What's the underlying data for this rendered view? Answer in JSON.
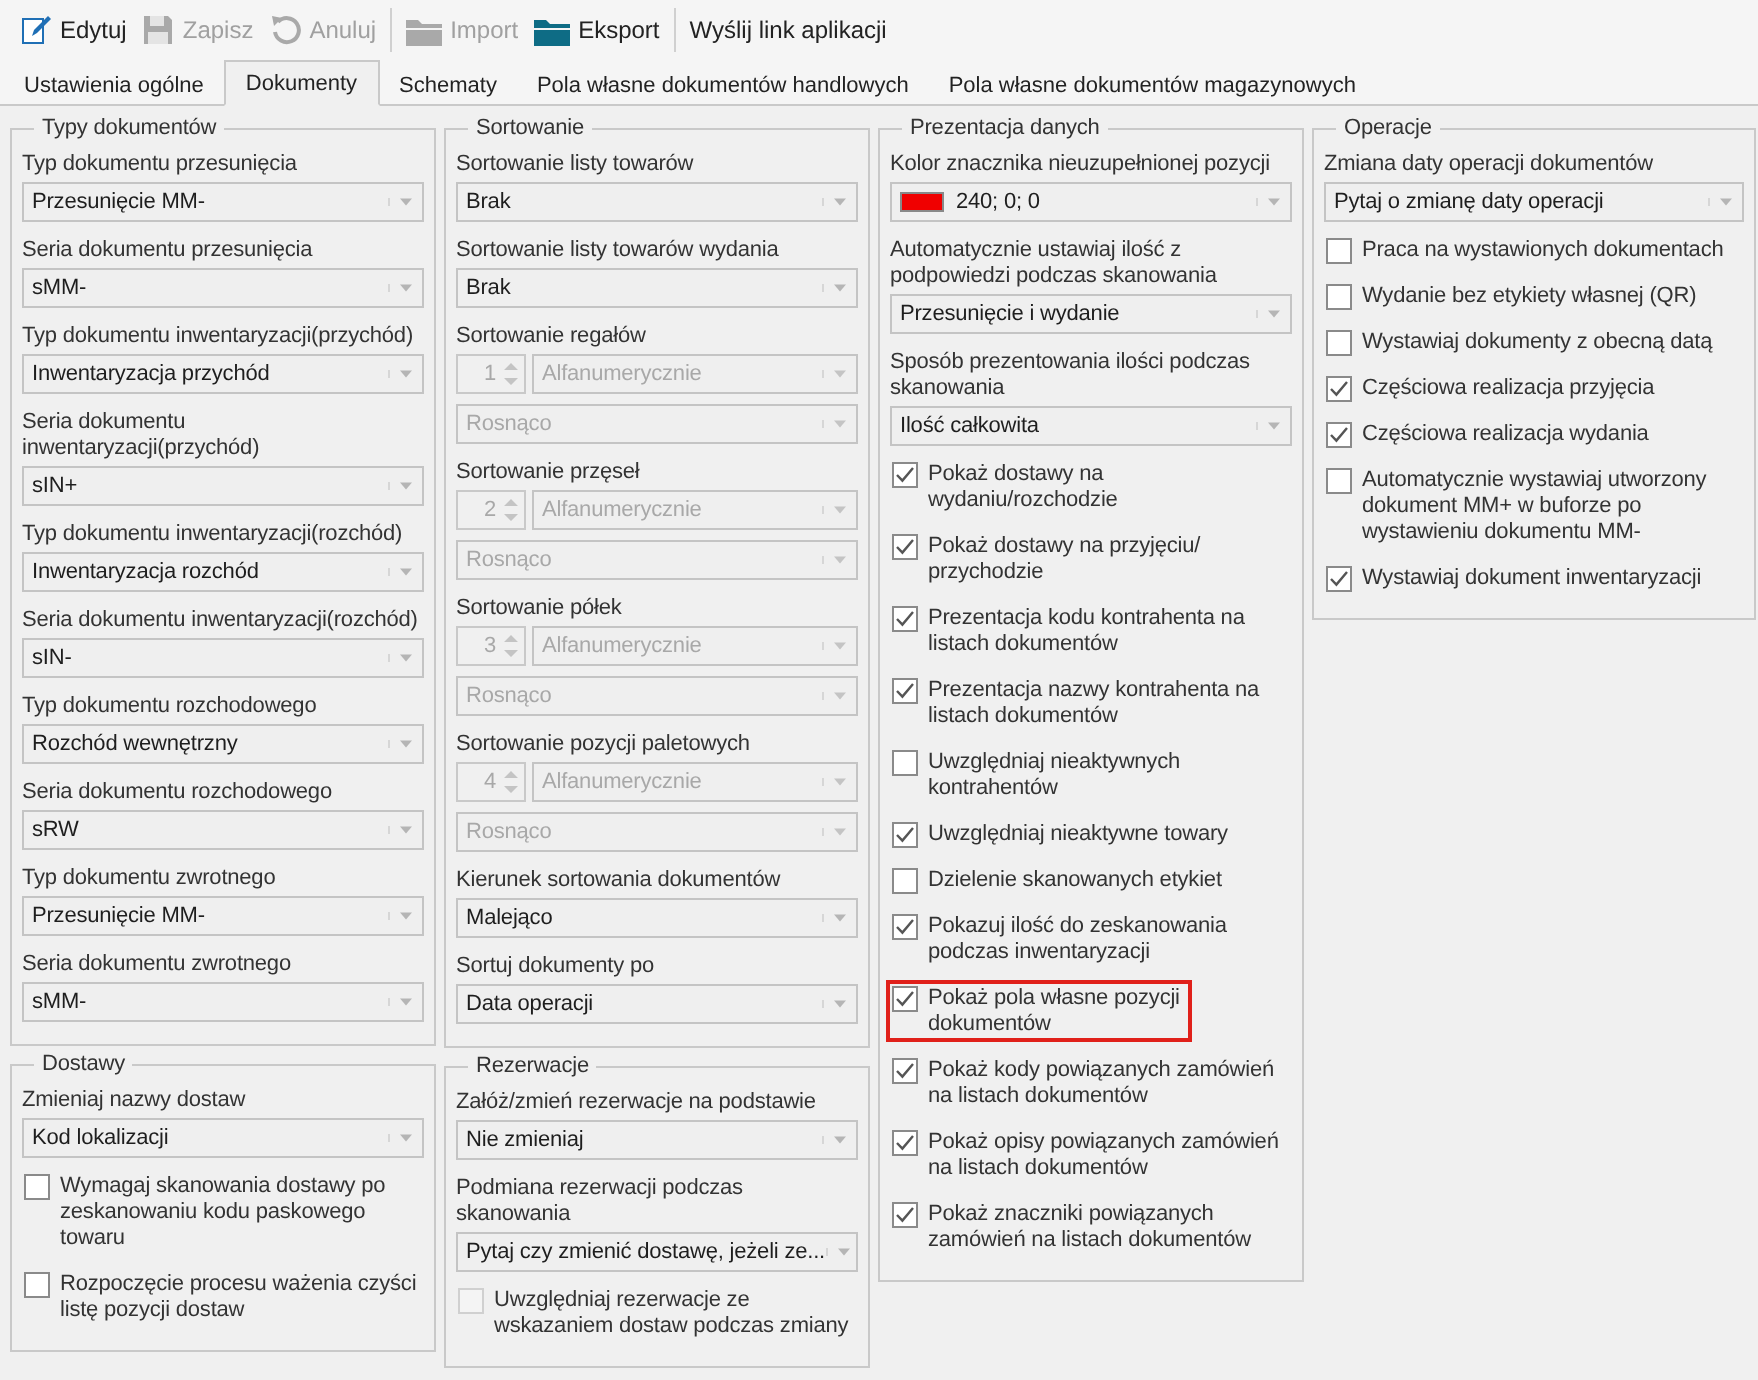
{
  "toolbar": [
    [
      {
        "label": "Edytuj",
        "kind": "edit",
        "disabled": false
      },
      {
        "label": "Zapisz",
        "kind": "save",
        "disabled": true
      },
      {
        "label": "Anuluj",
        "kind": "undo",
        "disabled": true
      }
    ],
    [
      {
        "label": "Import",
        "kind": "folder",
        "disabled": true
      },
      {
        "label": "Eksport",
        "kind": "folder",
        "disabled": false
      }
    ],
    [
      {
        "label": "Wyślij link aplikacji",
        "kind": "text",
        "disabled": false
      }
    ]
  ],
  "tabs": [
    {
      "label": "Ustawienia ogólne",
      "selected": false
    },
    {
      "label": "Dokumenty",
      "selected": true
    },
    {
      "label": "Schematy",
      "selected": false
    },
    {
      "label": "Pola własne dokumentów handlowych",
      "selected": false
    },
    {
      "label": "Pola własne dokumentów magazynowych",
      "selected": false
    }
  ],
  "columns": [
    {
      "groups": [
        {
          "title": "Typy dokumentów",
          "items": [
            {
              "kind": "select",
              "label": "Typ dokumentu przesunięcia",
              "value": "Przesunięcie MM-"
            },
            {
              "kind": "select",
              "label": "Seria dokumentu przesunięcia",
              "value": "sMM-"
            },
            {
              "kind": "select",
              "label": "Typ dokumentu inwentaryzacji(przychód)",
              "value": "Inwentaryzacja przychód"
            },
            {
              "kind": "select",
              "label": "Seria dokumentu inwentaryzacji(przychód)",
              "value": "sIN+"
            },
            {
              "kind": "select",
              "label": "Typ dokumentu inwentaryzacji(rozchód)",
              "value": "Inwentaryzacja rozchód"
            },
            {
              "kind": "select",
              "label": "Seria dokumentu inwentaryzacji(rozchód)",
              "value": "sIN-"
            },
            {
              "kind": "select",
              "label": "Typ dokumentu rozchodowego",
              "value": "Rozchód wewnętrzny"
            },
            {
              "kind": "select",
              "label": "Seria dokumentu rozchodowego",
              "value": "sRW"
            },
            {
              "kind": "select",
              "label": "Typ dokumentu zwrotnego",
              "value": "Przesunięcie MM-"
            },
            {
              "kind": "select",
              "label": "Seria dokumentu zwrotnego",
              "value": "sMM-"
            }
          ]
        },
        {
          "title": "Dostawy",
          "items": [
            {
              "kind": "select",
              "label": "Zmieniaj nazwy dostaw",
              "value": "Kod lokalizacji"
            },
            {
              "kind": "checkbox",
              "label": "Wymagaj skanowania dostawy po zeskanowaniu kodu paskowego towaru",
              "checked": false,
              "disabled": false,
              "highlighted": false
            },
            {
              "kind": "checkbox",
              "label": "Rozpoczęcie procesu ważenia czyści listę pozycji dostaw",
              "checked": false,
              "disabled": false,
              "highlighted": false
            }
          ]
        }
      ]
    },
    {
      "groups": [
        {
          "title": "Sortowanie",
          "items": [
            {
              "kind": "select",
              "label": "Sortowanie listy towarów",
              "value": "Brak"
            },
            {
              "kind": "select",
              "label": "Sortowanie listy towarów wydania",
              "value": "Brak"
            },
            {
              "kind": "sort",
              "label": "Sortowanie regałów",
              "number": "1",
              "mode": "Alfanumerycznie",
              "direction": "Rosnąco"
            },
            {
              "kind": "sort",
              "label": "Sortowanie przęseł",
              "number": "2",
              "mode": "Alfanumerycznie",
              "direction": "Rosnąco"
            },
            {
              "kind": "sort",
              "label": "Sortowanie półek",
              "number": "3",
              "mode": "Alfanumerycznie",
              "direction": "Rosnąco"
            },
            {
              "kind": "sort",
              "label": "Sortowanie pozycji paletowych",
              "number": "4",
              "mode": "Alfanumerycznie",
              "direction": "Rosnąco"
            },
            {
              "kind": "select",
              "label": "Kierunek sortowania dokumentów",
              "value": "Malejąco"
            },
            {
              "kind": "select",
              "label": "Sortuj dokumenty po",
              "value": "Data operacji"
            }
          ]
        },
        {
          "title": "Rezerwacje",
          "items": [
            {
              "kind": "select",
              "label": "Załóż/zmień rezerwacje na podstawie",
              "value": "Nie zmieniaj"
            },
            {
              "kind": "select",
              "label": "Podmiana rezerwacji podczas skanowania",
              "value": "Pytaj czy zmienić dostawę, jeżeli ze..."
            },
            {
              "kind": "checkbox",
              "label": "Uwzględniaj rezerwacje ze wskazaniem dostaw podczas zmiany",
              "checked": false,
              "disabled": true,
              "highlighted": false
            }
          ]
        }
      ]
    },
    {
      "groups": [
        {
          "title": "Prezentacja danych",
          "items": [
            {
              "kind": "color",
              "label": "Kolor znacznika nieuzupełnionej pozycji",
              "color": "#f00000",
              "value": "240; 0; 0"
            },
            {
              "kind": "select",
              "label": "Automatycznie ustawiaj ilość z podpowiedzi podczas skanowania",
              "value": "Przesunięcie i wydanie"
            },
            {
              "kind": "select",
              "label": "Sposób prezentowania ilości podczas skanowania",
              "value": "Ilość całkowita"
            },
            {
              "kind": "checkbox",
              "label": "Pokaż dostawy na wydaniu/rozchodzie",
              "checked": true,
              "disabled": false,
              "highlighted": false
            },
            {
              "kind": "checkbox",
              "label": "Pokaż dostawy na przyjęciu/ przychodzie",
              "checked": true,
              "disabled": false,
              "highlighted": false
            },
            {
              "kind": "checkbox",
              "label": "Prezentacja kodu kontrahenta na listach dokumentów",
              "checked": true,
              "disabled": false,
              "highlighted": false
            },
            {
              "kind": "checkbox",
              "label": "Prezentacja nazwy kontrahenta na listach dokumentów",
              "checked": true,
              "disabled": false,
              "highlighted": false
            },
            {
              "kind": "checkbox",
              "label": "Uwzględniaj nieaktywnych kontrahentów",
              "checked": false,
              "disabled": false,
              "highlighted": false
            },
            {
              "kind": "checkbox",
              "label": "Uwzględniaj nieaktywne towary",
              "checked": true,
              "disabled": false,
              "highlighted": false
            },
            {
              "kind": "checkbox",
              "label": "Dzielenie skanowanych etykiet",
              "checked": false,
              "disabled": false,
              "highlighted": false
            },
            {
              "kind": "checkbox",
              "label": "Pokazuj ilość do zeskanowania podczas inwentaryzacji",
              "checked": true,
              "disabled": false,
              "highlighted": false
            },
            {
              "kind": "checkbox",
              "label": "Pokaż pola własne pozycji dokumentów",
              "checked": true,
              "disabled": false,
              "highlighted": true
            },
            {
              "kind": "checkbox",
              "label": "Pokaż kody powiązanych zamówień na listach dokumentów",
              "checked": true,
              "disabled": false,
              "highlighted": false
            },
            {
              "kind": "checkbox",
              "label": "Pokaż opisy powiązanych zamówień na listach dokumentów",
              "checked": true,
              "disabled": false,
              "highlighted": false
            },
            {
              "kind": "checkbox",
              "label": "Pokaż znaczniki powiązanych zamówień na listach dokumentów",
              "checked": true,
              "disabled": false,
              "highlighted": false
            }
          ]
        }
      ]
    },
    {
      "groups": [
        {
          "title": "Operacje",
          "items": [
            {
              "kind": "select",
              "label": "Zmiana daty operacji dokumentów",
              "value": "Pytaj o zmianę daty operacji"
            },
            {
              "kind": "checkbox",
              "label": "Praca na wystawionych dokumentach",
              "checked": false,
              "disabled": false,
              "highlighted": false
            },
            {
              "kind": "checkbox",
              "label": "Wydanie bez etykiety własnej (QR)",
              "checked": false,
              "disabled": false,
              "highlighted": false
            },
            {
              "kind": "checkbox",
              "label": "Wystawiaj dokumenty z obecną datą",
              "checked": false,
              "disabled": false,
              "highlighted": false
            },
            {
              "kind": "checkbox",
              "label": "Częściowa realizacja przyjęcia",
              "checked": true,
              "disabled": false,
              "highlighted": false
            },
            {
              "kind": "checkbox",
              "label": "Częściowa realizacja wydania",
              "checked": true,
              "disabled": false,
              "highlighted": false
            },
            {
              "kind": "checkbox",
              "label": "Automatycznie wystawiaj utworzony dokument MM+ w buforze po wystawieniu dokumentu MM-",
              "checked": false,
              "disabled": false,
              "highlighted": false
            },
            {
              "kind": "checkbox",
              "label": "Wystawiaj dokument inwentaryzacji",
              "checked": true,
              "disabled": false,
              "highlighted": false
            }
          ]
        }
      ]
    }
  ]
}
